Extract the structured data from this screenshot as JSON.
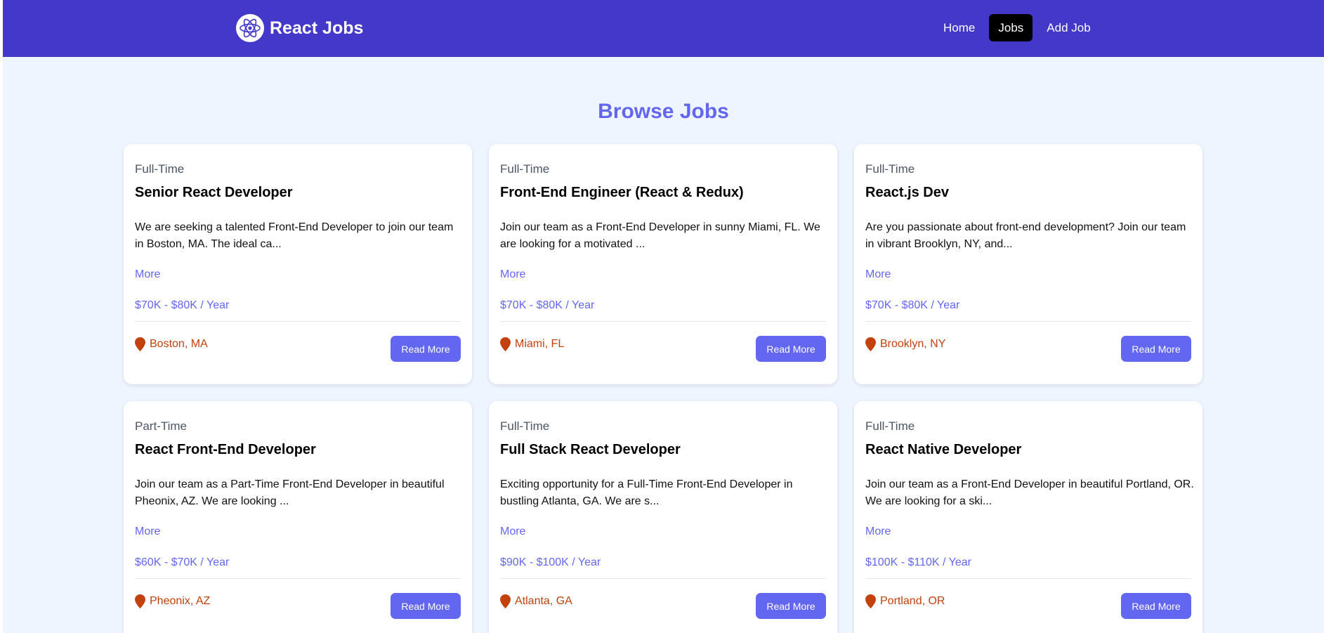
{
  "brand": {
    "name": "React Jobs",
    "logo_icon": "react-atom-icon"
  },
  "nav": [
    {
      "label": "Home",
      "active": false
    },
    {
      "label": "Jobs",
      "active": true
    },
    {
      "label": "Add Job",
      "active": false
    }
  ],
  "page": {
    "title": "Browse Jobs"
  },
  "colors": {
    "navbar": "#4338ca",
    "accent": "#6366f1",
    "location": "#c2410c",
    "background": "#eff5ff"
  },
  "jobs": [
    {
      "type": "Full-Time",
      "title": "Senior React Developer",
      "description": "We are seeking a talented Front-End Developer to join our team in Boston, MA. The ideal ca...",
      "more_label": "More",
      "salary": "$70K - $80K / Year",
      "location": "Boston, MA",
      "button_label": "Read More"
    },
    {
      "type": "Full-Time",
      "title": "Front-End Engineer (React & Redux)",
      "description": "Join our team as a Front-End Developer in sunny Miami, FL. We are looking for a motivated ...",
      "more_label": "More",
      "salary": "$70K - $80K / Year",
      "location": "Miami, FL",
      "button_label": "Read More"
    },
    {
      "type": "Full-Time",
      "title": "React.js Dev",
      "description": "Are you passionate about front-end development? Join our team in vibrant Brooklyn, NY, and...",
      "more_label": "More",
      "salary": "$70K - $80K / Year",
      "location": "Brooklyn, NY",
      "button_label": "Read More"
    },
    {
      "type": "Part-Time",
      "title": "React Front-End Developer",
      "description": "Join our team as a Part-Time Front-End Developer in beautiful Pheonix, AZ. We are looking ...",
      "more_label": "More",
      "salary": "$60K - $70K / Year",
      "location": "Pheonix, AZ",
      "button_label": "Read More"
    },
    {
      "type": "Full-Time",
      "title": "Full Stack React Developer",
      "description": "Exciting opportunity for a Full-Time Front-End Developer in bustling Atlanta, GA. We are s...",
      "more_label": "More",
      "salary": "$90K - $100K / Year",
      "location": "Atlanta, GA",
      "button_label": "Read More"
    },
    {
      "type": "Full-Time",
      "title": "React Native Developer",
      "description": "Join our team as a Front-End Developer in beautiful Portland, OR. We are looking for a ski...",
      "more_label": "More",
      "salary": "$100K - $110K / Year",
      "location": "Portland, OR",
      "button_label": "Read More"
    }
  ]
}
